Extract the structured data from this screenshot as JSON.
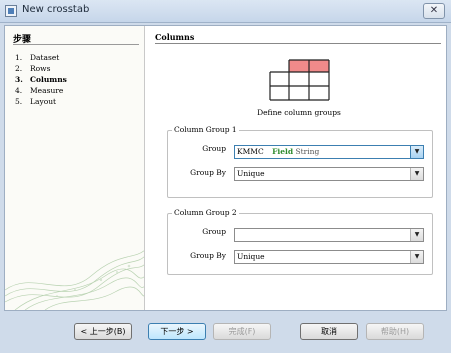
{
  "window": {
    "title": "New crosstab",
    "close_glyph": "✕"
  },
  "steps": {
    "title": "步骤",
    "items": [
      {
        "num": "1.",
        "label": "Dataset"
      },
      {
        "num": "2.",
        "label": "Rows"
      },
      {
        "num": "3.",
        "label": "Columns"
      },
      {
        "num": "4.",
        "label": "Measure"
      },
      {
        "num": "5.",
        "label": "Layout"
      }
    ],
    "active_index": 2
  },
  "main": {
    "section_title": "Columns",
    "description": "Define column groups",
    "group1": {
      "legend": "Column Group 1",
      "group_label": "Group",
      "group_value_name": "KMMC",
      "group_value_type": "Field",
      "group_value_kind": "String",
      "groupby_label": "Group By",
      "groupby_value": "Unique"
    },
    "group2": {
      "legend": "Column Group 2",
      "group_label": "Group",
      "group_value": "",
      "groupby_label": "Group By",
      "groupby_value": "Unique"
    }
  },
  "buttons": {
    "back": "< 上一步(B)",
    "next": "下一步 >",
    "finish": "完成(F)",
    "cancel": "取消",
    "help": "帮助(H)"
  },
  "colors": {
    "grid_highlight": "#f08a8a",
    "accent": "#3c7fb1"
  },
  "icons": {
    "dropdown": "▼"
  }
}
